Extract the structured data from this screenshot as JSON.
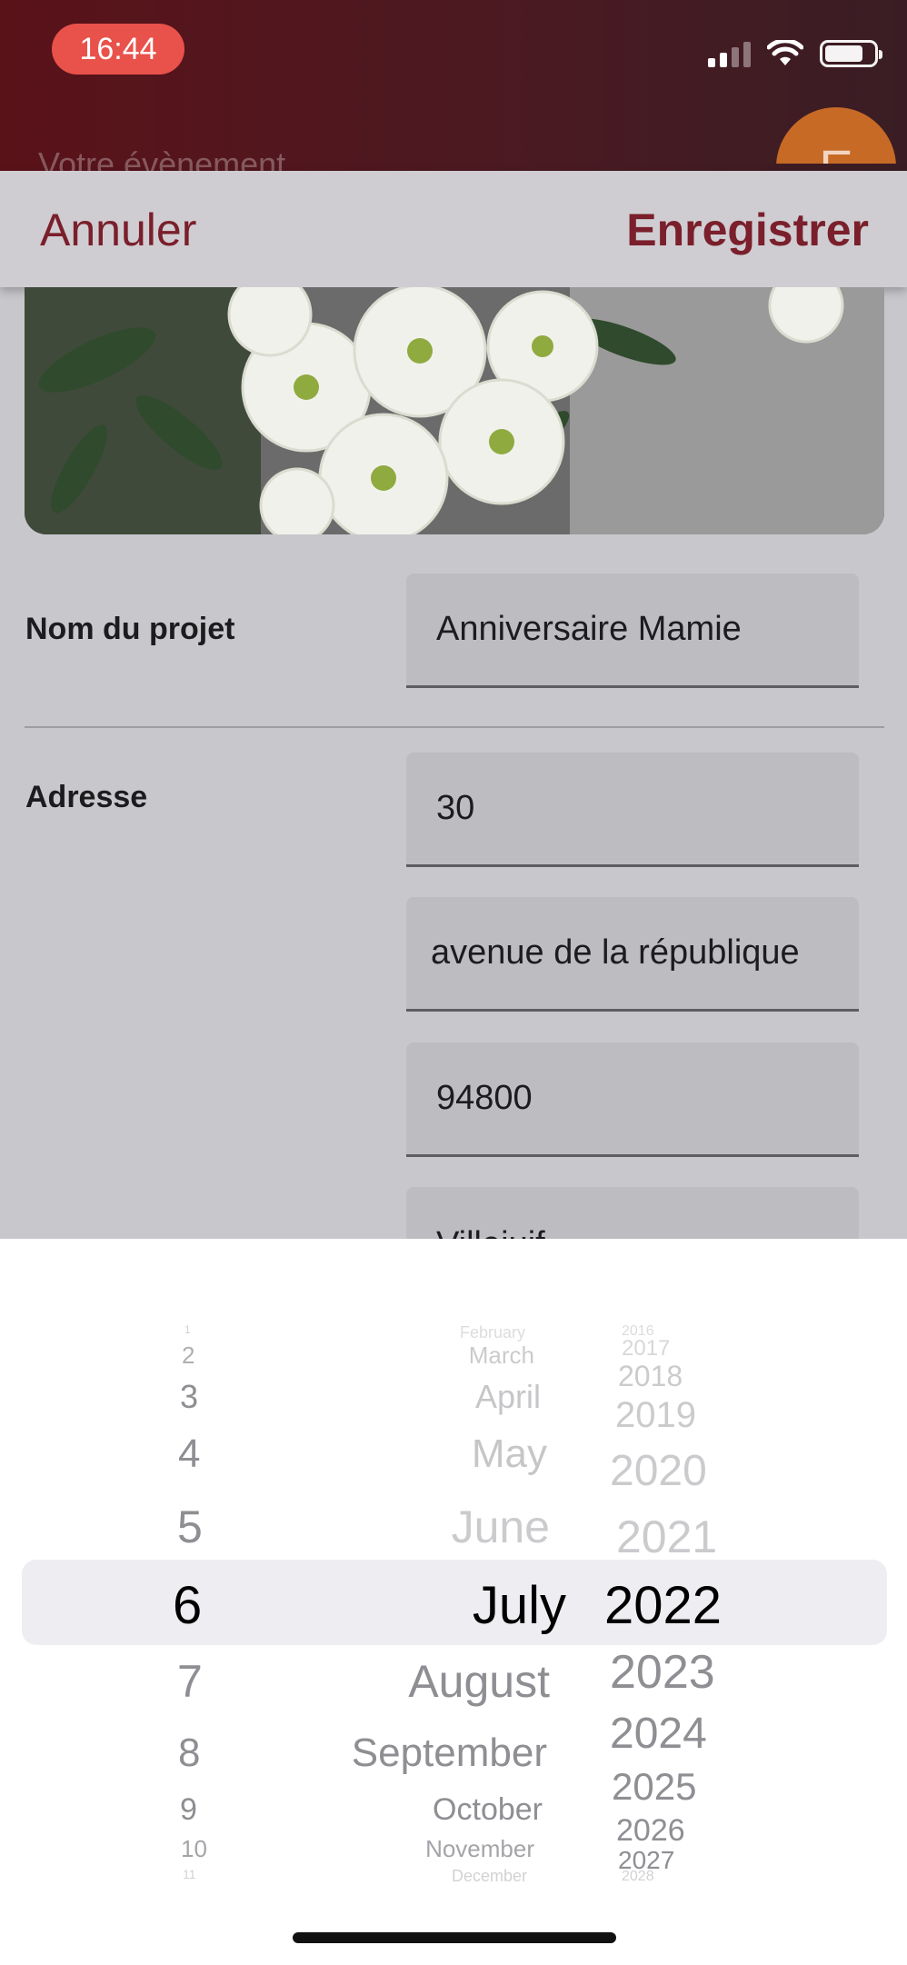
{
  "status_bar": {
    "time": "16:44",
    "icons": [
      "signal-icon",
      "wifi-icon",
      "battery-icon"
    ]
  },
  "background_screen": {
    "title": "Votre évènement",
    "avatar_initial": "E"
  },
  "action_bar": {
    "cancel_label": "Annuler",
    "save_label": "Enregistrer",
    "accent_color": "#7a1f2b"
  },
  "form": {
    "project_name_label": "Nom du projet",
    "project_name_value": "Anniversaire Mamie",
    "address_label": "Adresse",
    "address_number": "30",
    "address_street": "avenue de la république",
    "address_postcode": "94800",
    "address_city": "Villejuif"
  },
  "date_picker": {
    "days": [
      "1",
      "2",
      "3",
      "4",
      "5",
      "6",
      "7",
      "8",
      "9",
      "10",
      "11"
    ],
    "months": [
      "February",
      "March",
      "April",
      "May",
      "June",
      "July",
      "August",
      "September",
      "October",
      "November",
      "December"
    ],
    "years": [
      "2016",
      "2017",
      "2018",
      "2019",
      "2020",
      "2021",
      "2022",
      "2023",
      "2024",
      "2025",
      "2026",
      "2027",
      "2028"
    ],
    "selected_day": "6",
    "selected_month": "July",
    "selected_year": "2022"
  }
}
